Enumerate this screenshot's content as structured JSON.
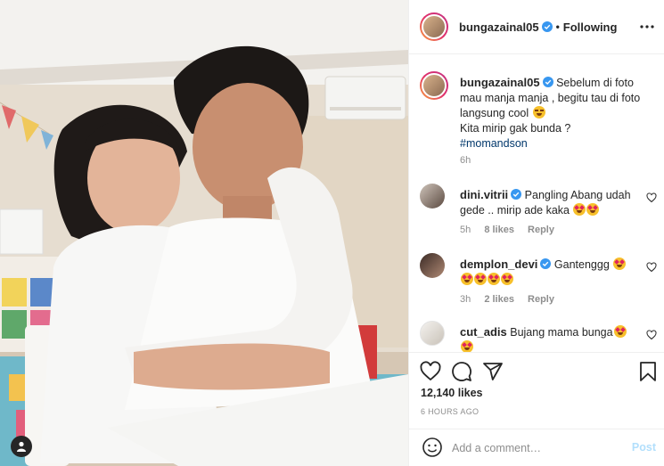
{
  "post": {
    "username": "bungazainal05",
    "follow_status": "Following",
    "separator": "•",
    "caption_lines": [
      "Sebelum di foto mau manja manja , begitu tau di foto langsung cool",
      "Kita mirip gak bunda ?"
    ],
    "hashtag": "#momandson",
    "caption_time": "6h",
    "likes": "12,140 likes",
    "posted_ago": "6 HOURS AGO"
  },
  "comments": [
    {
      "username": "dini.vitrii",
      "verified": true,
      "text": "Pangling Abang udah gede .. mirip ade kaka",
      "emoji_count": 2,
      "time": "5h",
      "likes": "8 likes",
      "reply": "Reply"
    },
    {
      "username": "demplon_devi",
      "verified": true,
      "text": "Gantenggg",
      "emoji_count": 5,
      "time": "3h",
      "likes": "2 likes",
      "reply": "Reply"
    },
    {
      "username": "cut_adis",
      "verified": false,
      "text": "Bujang mama bunga",
      "emoji_count": 2,
      "time": "",
      "likes": "",
      "reply": ""
    }
  ],
  "add_comment": {
    "placeholder": "Add a comment…",
    "post_label": "Post"
  },
  "icons": [
    "user-tag-icon",
    "verified-badge-icon",
    "more-options-icon",
    "heart-icon",
    "comment-icon",
    "share-icon",
    "save-bookmark-icon",
    "emoji-smile-icon",
    "heart-small-icon"
  ],
  "colors": {
    "text": "#262626",
    "secondary": "#8e8e8e",
    "link": "#00376b",
    "verified": "#3897f0",
    "post_disabled": "#b2dffc",
    "border": "#efefef"
  }
}
